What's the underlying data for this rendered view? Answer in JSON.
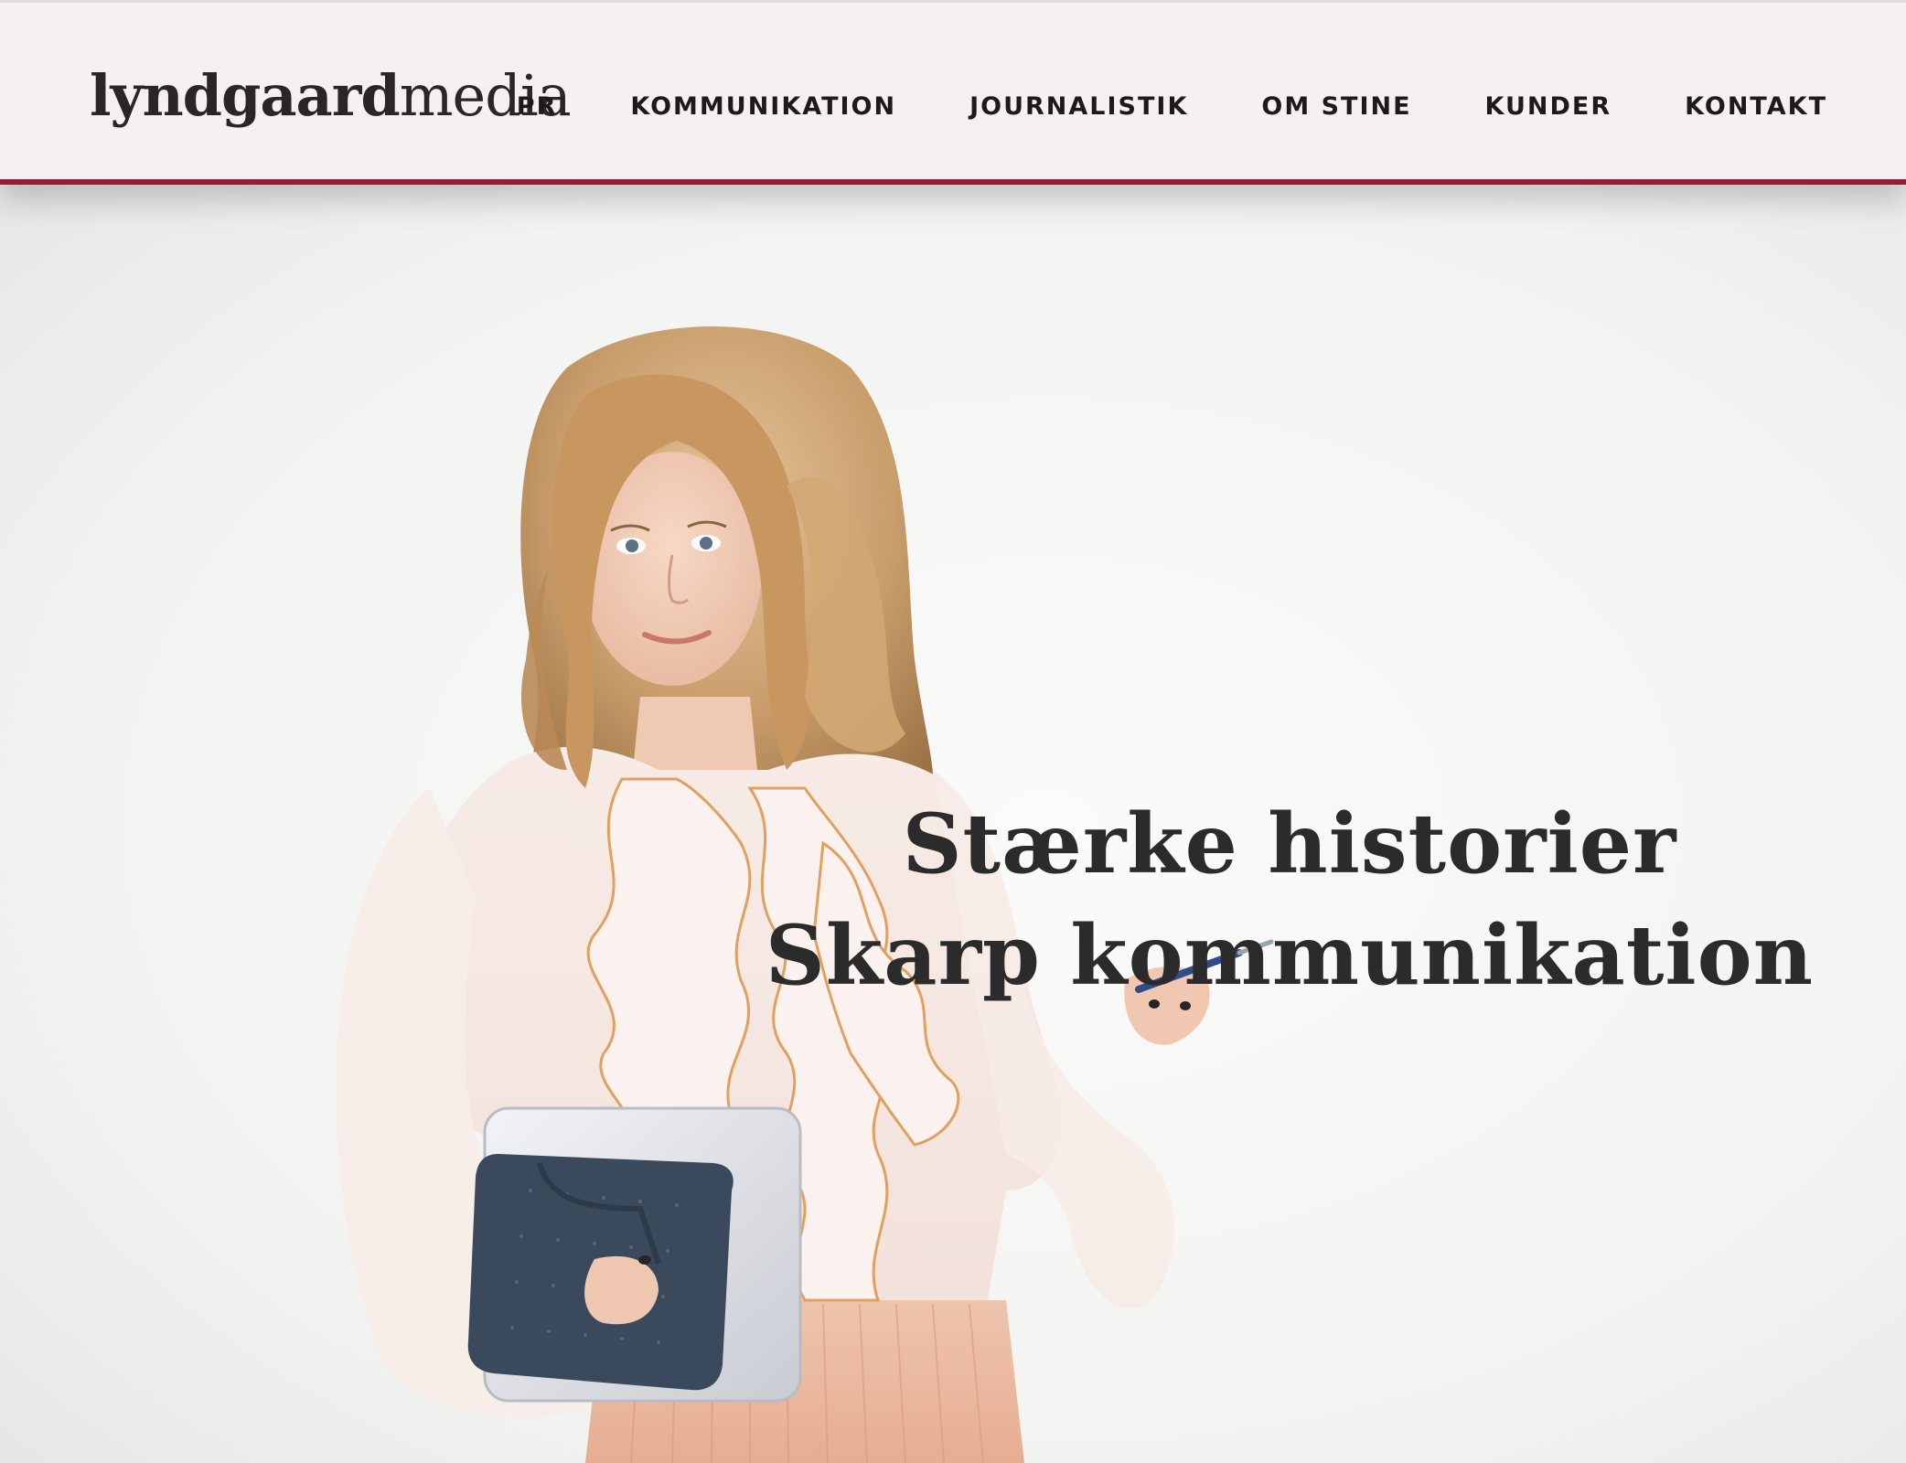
{
  "brand": {
    "logo_bold": "lyndgaard",
    "logo_light": "media"
  },
  "nav": {
    "items": [
      {
        "label": "PR"
      },
      {
        "label": "KOMMUNIKATION"
      },
      {
        "label": "JOURNALISTIK"
      },
      {
        "label": "OM STINE"
      },
      {
        "label": "KUNDER"
      },
      {
        "label": "KONTAKT"
      }
    ]
  },
  "hero": {
    "line1": "Stærke historier",
    "line2": "Skarp kommunikation"
  },
  "colors": {
    "header_bg": "#f6f0f0",
    "accent": "#9a1838",
    "text": "#1b1b1b"
  }
}
